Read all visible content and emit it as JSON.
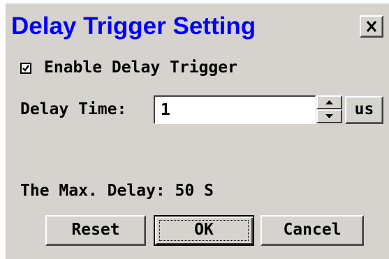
{
  "window": {
    "title": "Delay Trigger Setting",
    "close_icon": "close-x-icon"
  },
  "enable_delay": {
    "label": "Enable Delay Trigger",
    "checked": true
  },
  "delay_time": {
    "label": "Delay Time:",
    "value": "1",
    "unit": "us",
    "spin_up_icon": "triangle-up-icon",
    "spin_down_icon": "triangle-down-icon"
  },
  "max_delay": {
    "text": "The Max. Delay: 50 S"
  },
  "buttons": {
    "reset": "Reset",
    "ok": "OK",
    "cancel": "Cancel"
  },
  "colors": {
    "title": "#0000ff",
    "dialog_bg": "#d6d3ce"
  }
}
